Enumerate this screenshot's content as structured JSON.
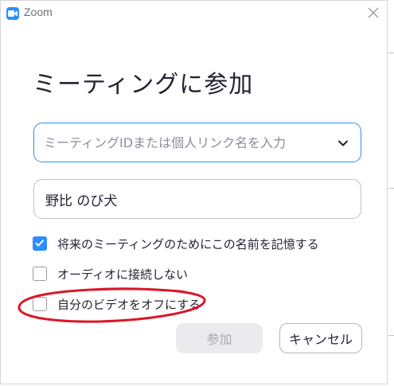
{
  "window": {
    "title": "Zoom",
    "app_icon": "zoom-camera-icon",
    "close_icon": "close-icon"
  },
  "dialog": {
    "heading": "ミーティングに参加",
    "meeting_id_field": {
      "placeholder": "ミーティングIDまたは個人リンク名を入力",
      "value": "",
      "dropdown_icon": "chevron-down-icon"
    },
    "name_field": {
      "value": "野比 のび犬"
    },
    "options": [
      {
        "label": "将来のミーティングのためにこの名前を記憶する",
        "checked": true
      },
      {
        "label": "オーディオに接続しない",
        "checked": false
      },
      {
        "label": "自分のビデオをオフにする",
        "checked": false
      }
    ],
    "buttons": {
      "join": "参加",
      "cancel": "キャンセル"
    }
  },
  "colors": {
    "accent": "#2d8cff",
    "annotation": "#d9182a",
    "disabled_button_bg": "#ebebee",
    "disabled_button_text": "#a8a8b0"
  }
}
